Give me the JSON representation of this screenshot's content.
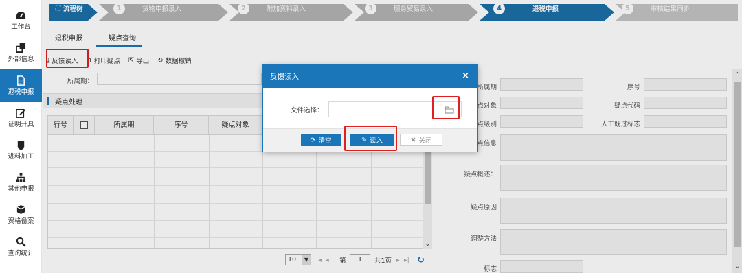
{
  "sidebar": {
    "items": [
      {
        "label": "工作台",
        "icon": "dashboard-icon"
      },
      {
        "label": "外部信息",
        "icon": "window-icon"
      },
      {
        "label": "退税申报",
        "icon": "document-icon",
        "active": true
      },
      {
        "label": "证明开具",
        "icon": "edit-icon"
      },
      {
        "label": "进料加工",
        "icon": "shield-icon"
      },
      {
        "label": "其他申报",
        "icon": "sitemap-icon"
      },
      {
        "label": "资格备案",
        "icon": "cube-icon"
      },
      {
        "label": "查询统计",
        "icon": "search-icon"
      }
    ]
  },
  "stepbar": {
    "root_label": "流程树",
    "steps": [
      {
        "num": "1",
        "label": "货物申报录入"
      },
      {
        "num": "2",
        "label": "附加资料录入"
      },
      {
        "num": "3",
        "label": "服务贸易录入"
      },
      {
        "num": "4",
        "label": "退税申报",
        "active": true
      },
      {
        "num": "5",
        "label": "审核结果同步"
      }
    ],
    "colors": {
      "active": "#1c6fa8",
      "inactive": "#b0b0b0",
      "root": "#1c6fa8"
    }
  },
  "tabs": [
    {
      "label": "退税申报"
    },
    {
      "label": "疑点查询",
      "active": true
    }
  ],
  "toolbar": {
    "buttons": [
      {
        "label": "反馈读入",
        "icon": "download-icon"
      },
      {
        "label": "打印疑点",
        "icon": "undo-arrow-icon"
      },
      {
        "label": "导出",
        "icon": "export-icon"
      },
      {
        "label": "数据撤销",
        "icon": "redo-icon"
      }
    ]
  },
  "filter": {
    "period_label": "所属期："
  },
  "panel": {
    "title": "疑点处理",
    "columns": [
      "行号",
      "",
      "所属期",
      "序号",
      "疑点对象",
      "",
      "",
      ""
    ]
  },
  "pager": {
    "page_size": "10",
    "page_prefix": "第",
    "page_value": "1",
    "page_total": "共1页"
  },
  "detail": {
    "labels": {
      "period": "所属期",
      "seq": "序号",
      "object": "疑点对象",
      "code": "疑点代码",
      "level": "疑点级别",
      "manual_flag": "人工既过标志",
      "info": "疑点信息",
      "summary": "疑点概述：",
      "reason": "疑点原因",
      "method": "调整方法",
      "flag": "标志"
    }
  },
  "modal": {
    "title": "反馈读入",
    "close": "×",
    "file_label": "文件选择：",
    "clear_label": "清空",
    "read_label": "读入",
    "close_label": "关闭"
  },
  "colors": {
    "accent": "#1a76b8",
    "highlight": "#e02020"
  }
}
